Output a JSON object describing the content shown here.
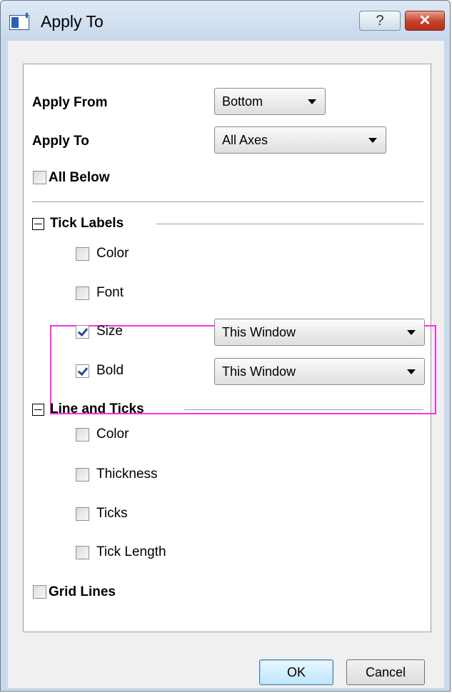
{
  "window": {
    "title": "Apply To",
    "help_label": "?",
    "close_label": "✕"
  },
  "apply_from": {
    "label": "Apply From",
    "value": "Bottom"
  },
  "apply_to": {
    "label": "Apply To",
    "value": "All Axes"
  },
  "all_below": {
    "label": "All Below",
    "checked": false
  },
  "tick_labels": {
    "label": "Tick Labels",
    "color": {
      "label": "Color",
      "checked": false
    },
    "font": {
      "label": "Font",
      "checked": false
    },
    "size": {
      "label": "Size",
      "checked": true,
      "value": "This Window"
    },
    "bold": {
      "label": "Bold",
      "checked": true,
      "value": "This Window"
    }
  },
  "line_and_ticks": {
    "label": "Line and Ticks",
    "color": {
      "label": "Color",
      "checked": false
    },
    "thickness": {
      "label": "Thickness",
      "checked": false
    },
    "ticks": {
      "label": "Ticks",
      "checked": false
    },
    "tick_length": {
      "label": "Tick Length",
      "checked": false
    }
  },
  "grid_lines": {
    "label": "Grid Lines",
    "checked": false
  },
  "buttons": {
    "ok": "OK",
    "cancel": "Cancel"
  },
  "colors": {
    "highlight": "#ff2ee4",
    "close_button": "#c5412a",
    "title_bar": "#c6d8ec"
  }
}
